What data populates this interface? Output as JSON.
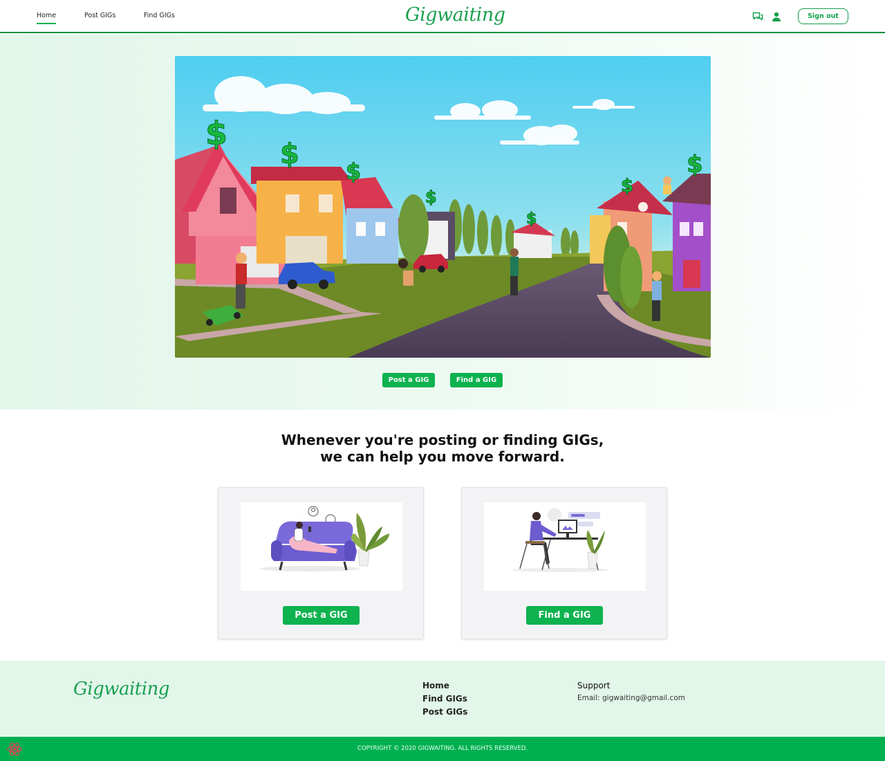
{
  "nav": {
    "items": [
      {
        "label": "Home",
        "active": true
      },
      {
        "label": "Post GIGs",
        "active": false
      },
      {
        "label": "Find GIGs",
        "active": false
      }
    ],
    "brand": "Gigwaiting",
    "icons": [
      "chat-icon",
      "user-icon"
    ],
    "signout_label": "Sign out"
  },
  "hero": {
    "post_label": "Post a GIG",
    "find_label": "Find a GIG"
  },
  "tagline": {
    "line1": "Whenever you're posting or finding GIGs,",
    "line2": "we can help you move forward."
  },
  "cards": [
    {
      "button_label": "Post a GIG"
    },
    {
      "button_label": "Find a GIG"
    }
  ],
  "footer": {
    "brand": "Gigwaiting",
    "links": [
      "Home",
      "Find GIGs",
      "Post GIGs"
    ],
    "support_title": "Support",
    "support_email": "Email: gigwaiting@gmail.com",
    "copyright": "COPYRIGHT © 2020 GIGWAITING. ALL RIGHTS RESERVED."
  },
  "colors": {
    "accent": "#00b050",
    "brand_text": "#1aa050",
    "footer_bg": "#e2f6ea"
  }
}
